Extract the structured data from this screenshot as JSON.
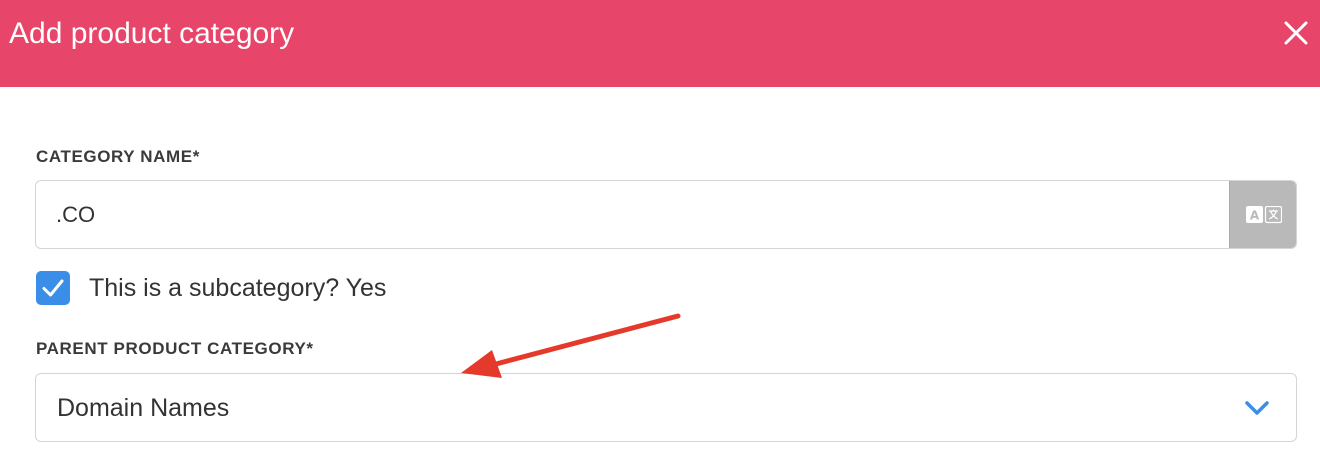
{
  "modal": {
    "title": "Add product category",
    "close_icon": "close-icon",
    "header_color": "#e8456a"
  },
  "form": {
    "category_name": {
      "label": "CATEGORY NAME*",
      "value": ".CO",
      "translate_icon": "translate-icon"
    },
    "subcategory": {
      "checked": true,
      "label": "This is a subcategory? Yes",
      "checkbox_color": "#3a8ee8"
    },
    "parent_category": {
      "label": "PARENT PRODUCT CATEGORY*",
      "selected": "Domain Names",
      "chevron_icon": "chevron-down-icon",
      "chevron_color": "#3a8ee8"
    }
  },
  "annotation": {
    "arrow_color": "#e53a2b"
  }
}
